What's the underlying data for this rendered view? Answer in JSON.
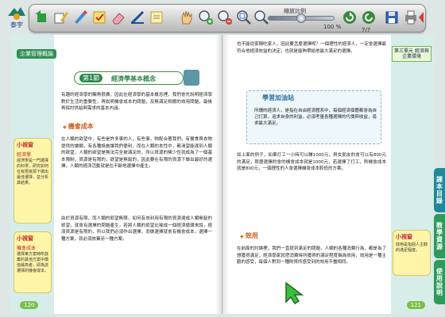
{
  "brand": {
    "logo_text": "泰宇"
  },
  "toolbar": {
    "icons": [
      "home-arrow-icon",
      "pencil-icon",
      "brush-icon",
      "stamp-icon",
      "eraser-icon",
      "ruler-icon",
      "note-icon",
      "hand-icon",
      "zoom-in-icon",
      "zoom-out-icon",
      "fit-page-icon",
      "zoom-reset-icon",
      "history-icon",
      "back-icon",
      "save-icon",
      "print-icon",
      "close-tab-icon"
    ],
    "zoom_label": "縮放比例",
    "zoom_value": "100 %",
    "zoom_level": 1.0,
    "page_count": "7/7"
  },
  "left_page": {
    "chapter_tag": "企業管理概論",
    "section_number": "第1節",
    "section_title": "經濟學基本概念",
    "intro": "有趣的經濟學的觸角很廣，因此在經濟學的基本概念裡，我們會先說明經濟學對於生活的重要性，再說明機會成本的問題，及無滿足相關的效用問題，最後再探討供給與需求的基本內涵。",
    "subhead_1": "機會成本",
    "para_1": "在人類的欲望中，有些是許多事的人，有些事，物配合著我們。有醫食與衣物提供的讓類，有各種設施讓我們便利，而在人類的本性中，都渴望能達到人類的欲望，人類的欲望是無法完全被滿足的，所以資源的稀少性就成為了一個基本限制，資源是有限的，欲望是無窮的，因此要在有限的資源下做出最好的選擇，人類的經濟活動就是在不斷地選擇中產生。",
    "para_2": "由於資源有限，而人類的慾望無限，如何有效利用有限的資源達成人類無窮的慾望，就會有選擇的問題產生，若將人類的慾望比喻成一個經濟循環來說，經濟資源是有限的，所以我們必須作出選擇，而做選擇就會有機會成本，選擇一種方案，就必須放棄另一種方案。",
    "tip_1": {
      "title": "小視窗",
      "subtitle": "經濟學",
      "body": "經濟學是一門選擇的科學，研究如何在有限資源下做出最佳選擇，並分析其結果。"
    },
    "tip_2": {
      "title": "小視窗",
      "subtitle": "機會成本",
      "body": "選擇某方案時所放棄的其他方案中價值最高者，即為該選擇的機會成本。"
    },
    "page_number": "120"
  },
  "right_page": {
    "section_tag": "第三單元 經濟與企業環境",
    "para_top": "也不能從家鍋吃家人，因此要怎麼選擇呢？一個理性的經濟人，一定會選擇最符合他經濟效益的決定，也就是能夠帶給他最大滿足的選擇。",
    "study_title": "學習加油站",
    "study_body": "所謂的經濟人，是指在自由經濟體系中，每個經濟個體都會為自己打算，追求自身的利益，必須考量各種選擇的代價與收益，尋求最大滿足。",
    "para_2": "如上面的例子，如果打工一小時可以賺1000元，與女朋友約會可以有800元的滿足，那麼選擇約會的機會成本就是1000元，若選擇了打工，則機會成本就是800元，一個理性的人會選擇機會成本較低的方案。",
    "subhead_2": "效用",
    "para_3": "在前面的討論裡，我們一直提到滿足的問題，人類的各種消費行為，都是為了想獲得滿足，經濟學家就把消費時所獲得的滿足程度稱為效用，效用是一種主觀的感受，每個人對同一種財貨所感受到的效用不盡相同。",
    "tip_3": {
      "title": "小視窗",
      "body": "效用是指個人主觀的滿足程度。"
    },
    "page_number": "121"
  },
  "side_tabs": [
    {
      "label": "課本目錄",
      "color": "#1f8a9a"
    },
    {
      "label": "教學資源",
      "color": "#2f9a5b"
    },
    {
      "label": "使用說明",
      "color": "#2f9a5b"
    }
  ]
}
